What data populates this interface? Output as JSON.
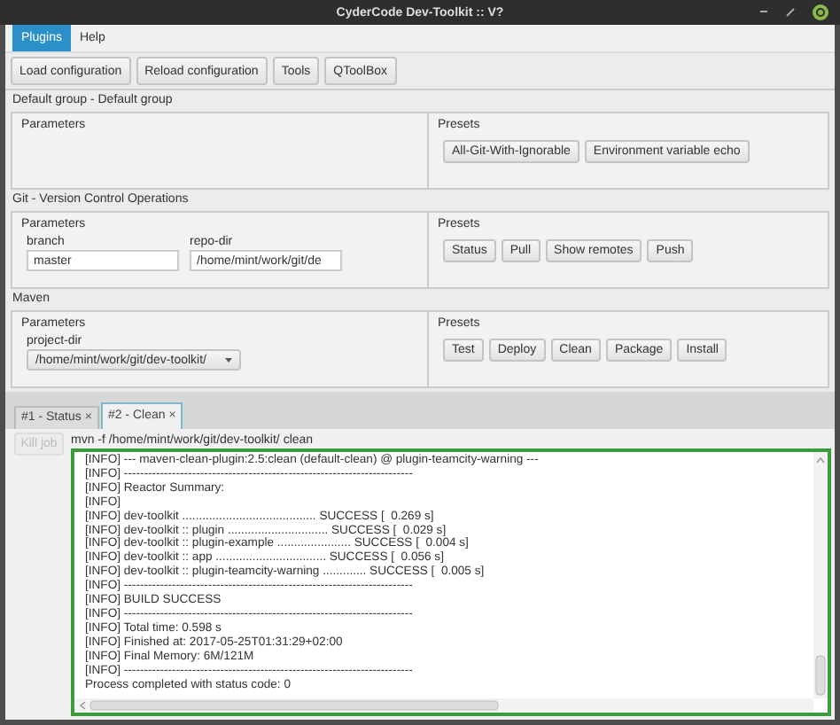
{
  "window": {
    "title": "CyderCode Dev-Toolkit :: V?"
  },
  "menu": [
    {
      "label": "Plugins",
      "selected": true
    },
    {
      "label": "Help",
      "selected": false
    }
  ],
  "toolbar": [
    "Load configuration",
    "Reload configuration",
    "Tools",
    "QToolBox"
  ],
  "groups": [
    {
      "title": "Default group - Default group",
      "parameters_title": "Parameters",
      "presets_title": "Presets",
      "presets": [
        "All-Git-With-Ignorable",
        "Environment variable echo"
      ]
    },
    {
      "title": "Git - Version Control Operations",
      "parameters_title": "Parameters",
      "presets_title": "Presets",
      "parameters": [
        {
          "kind": "text",
          "label": "branch",
          "value": "master"
        },
        {
          "kind": "text",
          "label": "repo-dir",
          "value": "/home/mint/work/git/de"
        }
      ],
      "presets": [
        "Status",
        "Pull",
        "Show remotes",
        "Push"
      ]
    },
    {
      "title": "Maven",
      "parameters_title": "Parameters",
      "presets_title": "Presets",
      "parameters": [
        {
          "kind": "select",
          "label": "project-dir",
          "value": "/home/mint/work/git/dev-toolkit/"
        }
      ],
      "presets": [
        "Test",
        "Deploy",
        "Clean",
        "Package",
        "Install"
      ]
    }
  ],
  "jobs": {
    "tabs": [
      {
        "label": "#1 - Status",
        "close": "×",
        "selected": false
      },
      {
        "label": "#2 - Clean",
        "close": "×",
        "selected": true
      }
    ],
    "kill_button": {
      "label": "Kill job",
      "disabled": true
    },
    "command": "mvn -f /home/mint/work/git/dev-toolkit/ clean",
    "log": [
      "[INFO] --- maven-clean-plugin:2.5:clean (default-clean) @ plugin-teamcity-warning ---",
      "[INFO] ------------------------------------------------------------------------",
      "[INFO] Reactor Summary:",
      "[INFO]",
      "[INFO] dev-toolkit ........................................ SUCCESS [  0.269 s]",
      "[INFO] dev-toolkit :: plugin .............................. SUCCESS [  0.029 s]",
      "[INFO] dev-toolkit :: plugin-example ...................... SUCCESS [  0.004 s]",
      "[INFO] dev-toolkit :: app ................................. SUCCESS [  0.056 s]",
      "[INFO] dev-toolkit :: plugin-teamcity-warning ............. SUCCESS [  0.005 s]",
      "[INFO] ------------------------------------------------------------------------",
      "[INFO] BUILD SUCCESS",
      "[INFO] ------------------------------------------------------------------------",
      "[INFO] Total time: 0.598 s",
      "[INFO] Finished at: 2017-05-25T01:31:29+02:00",
      "[INFO] Final Memory: 6M/121M",
      "[INFO] ------------------------------------------------------------------------",
      "Process completed with status code: 0"
    ]
  }
}
